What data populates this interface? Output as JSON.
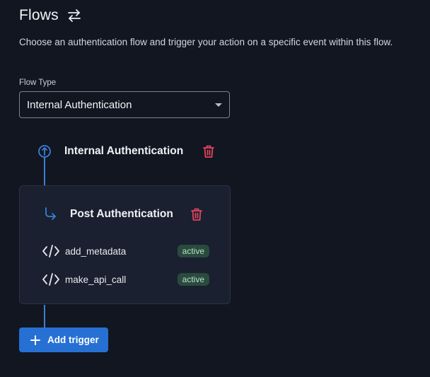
{
  "header": {
    "title": "Flows",
    "subtitle": "Choose an authentication flow and trigger your action on a specific event within this flow."
  },
  "flow_type": {
    "label": "Flow Type",
    "selected": "Internal Authentication"
  },
  "flow": {
    "name": "Internal Authentication",
    "event": {
      "name": "Post Authentication",
      "actions": [
        {
          "name": "add_metadata",
          "status": "active"
        },
        {
          "name": "make_api_call",
          "status": "active"
        }
      ]
    }
  },
  "add_trigger_label": "Add trigger",
  "colors": {
    "background": "#121620",
    "accent": "#2670d4",
    "timeline": "#3a7fd5",
    "delete": "#e0445e",
    "badge_bg": "#2a4a3d",
    "badge_text": "#b7e0c7"
  },
  "icons": [
    "swap-arrows-icon",
    "dropdown-caret-icon",
    "flow-node-icon",
    "trash-icon",
    "event-arrow-icon",
    "code-icon",
    "plus-icon"
  ]
}
